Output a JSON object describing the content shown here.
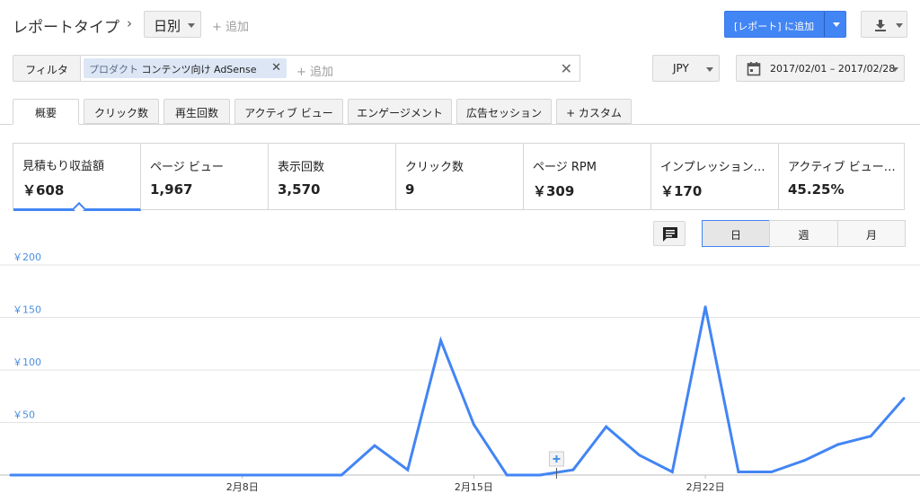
{
  "header": {
    "report_type_label": "レポートタイプ",
    "breadcrumb_chevron": "›",
    "granularity_dropdown": "日別",
    "add_label": "+ 追加",
    "add_to_report_button": "[レポート] に追加",
    "download_icon": "download-icon"
  },
  "filter": {
    "filter_button": "フィルタ",
    "chip_key": "プロダクト",
    "chip_value": "コンテンツ向け AdSense",
    "chip_close": "✕",
    "add_filter": "+ 追加",
    "clear": "✕"
  },
  "currency": {
    "value": "JPY"
  },
  "date_range": {
    "value": "2017/02/01 – 2017/02/28"
  },
  "tabs": [
    {
      "label": "概要",
      "active": true
    },
    {
      "label": "クリック数"
    },
    {
      "label": "再生回数"
    },
    {
      "label": "アクティブ ビュー"
    },
    {
      "label": "エンゲージメント"
    },
    {
      "label": "広告セッション"
    },
    {
      "label": "+ カスタム"
    }
  ],
  "metrics": [
    {
      "title": "見積もり収益額",
      "value": "￥608",
      "selected": true
    },
    {
      "title": "ページ ビュー",
      "value": "1,967"
    },
    {
      "title": "表示回数",
      "value": "3,570"
    },
    {
      "title": "クリック数",
      "value": "9"
    },
    {
      "title": "ページ RPM",
      "value": "￥309"
    },
    {
      "title": "インプレッション…",
      "value": "￥170"
    },
    {
      "title": "アクティブ ビュー…",
      "value": "45.25%"
    }
  ],
  "chart_toolbar": {
    "annotation_icon": "comment-icon",
    "periods": [
      {
        "label": "日",
        "selected": true
      },
      {
        "label": "週"
      },
      {
        "label": "月"
      }
    ]
  },
  "colors": {
    "accent": "#4285f4",
    "line": "#4285f4",
    "axis_label": "#4a90e2"
  },
  "chart_data": {
    "type": "line",
    "x": [
      "2/1",
      "2/2",
      "2/3",
      "2/4",
      "2/5",
      "2/6",
      "2/7",
      "2/8",
      "2/9",
      "2/10",
      "2/11",
      "2/12",
      "2/13",
      "2/14",
      "2/15",
      "2/16",
      "2/17",
      "2/18",
      "2/19",
      "2/20",
      "2/21",
      "2/22",
      "2/23",
      "2/24",
      "2/25",
      "2/26",
      "2/27",
      "2/28"
    ],
    "series": [
      {
        "values": [
          0,
          0,
          0,
          0,
          0,
          0,
          0,
          0,
          0,
          0,
          0,
          28,
          5,
          128,
          48,
          0,
          0,
          5,
          46,
          19,
          3,
          160,
          3,
          3,
          14,
          29,
          37,
          73
        ]
      }
    ],
    "xticks": [
      {
        "label": "2月8日",
        "index": 7
      },
      {
        "label": "2月15日",
        "index": 14
      },
      {
        "label": "2月22日",
        "index": 21
      }
    ],
    "yticks": [
      "￥200",
      "￥150",
      "￥100",
      "￥50"
    ],
    "ylim": [
      0,
      200
    ],
    "grid": true
  }
}
